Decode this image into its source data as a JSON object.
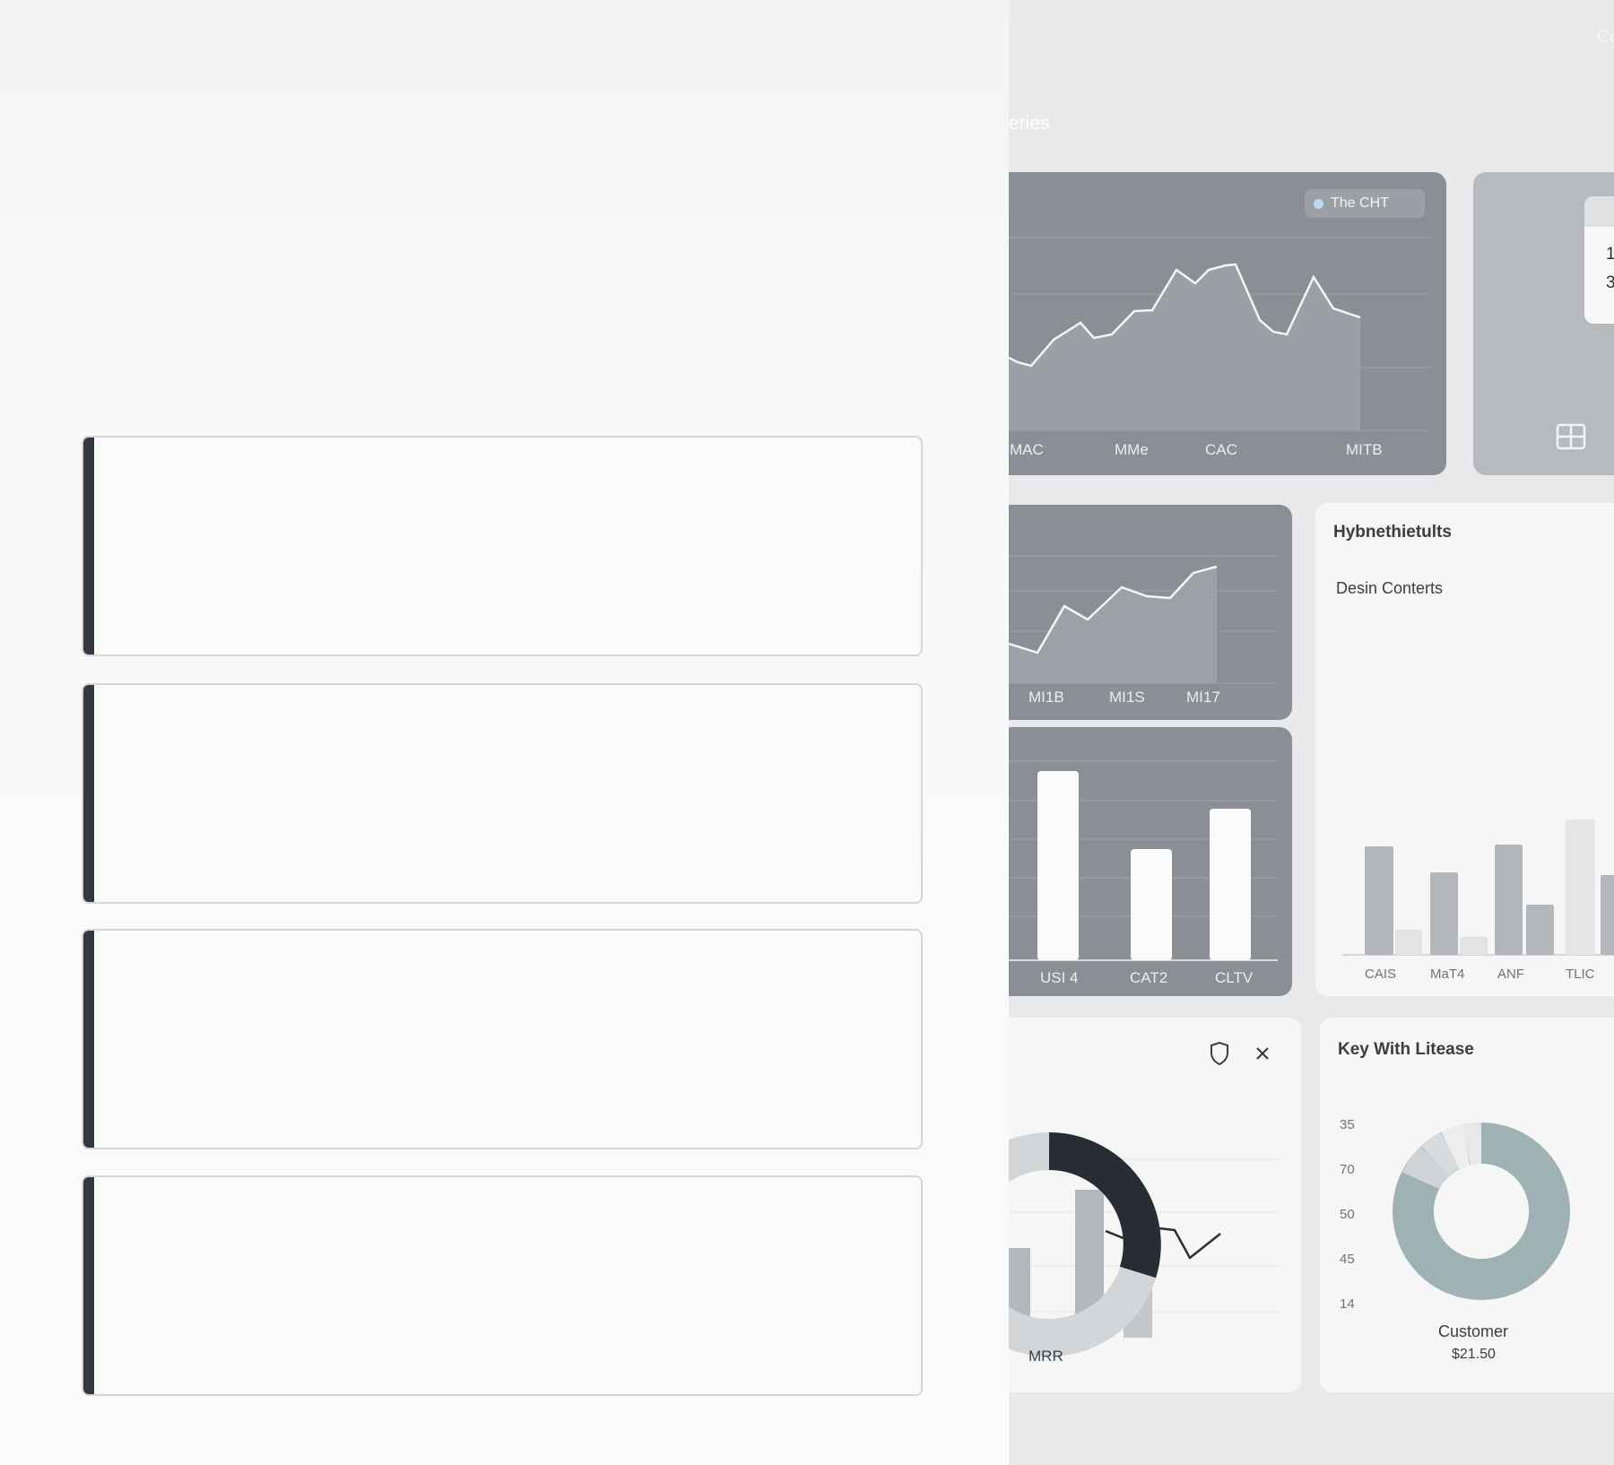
{
  "header": {
    "top_right_fragment": "Co",
    "section_fragment": "eries"
  },
  "panels": {
    "top_line": {
      "legend": "The CHT",
      "x_labels": [
        "MAC",
        "MMe",
        "CAC",
        "MITB"
      ]
    },
    "mid_line": {
      "x_labels": [
        "MI1B",
        "MI1S",
        "MI17"
      ]
    },
    "bar_gray": {
      "x_labels": [
        "USI 4",
        "CAT2",
        "CLTV"
      ]
    },
    "hybrid": {
      "title": "Hybnethietults",
      "subtitle": "Desin Conterts",
      "x_labels": [
        "CAIS",
        "MaT4",
        "ANF",
        "TLIC"
      ]
    },
    "donut_mrr": {
      "label": "MRR",
      "icons": [
        "shield-icon",
        "close-icon"
      ]
    },
    "key": {
      "title": "Key With Litease",
      "y_labels": [
        "35",
        "70",
        "50",
        "45",
        "14"
      ],
      "donut_label": "Customer",
      "donut_value": "$21.50"
    },
    "mini": {
      "values": [
        "1",
        "3"
      ],
      "icon": "grid-icon"
    }
  },
  "colors": {
    "dark_accent": "#323741",
    "panel_gray": "#8a8e95",
    "teal": "#9fb2b3",
    "dark_arc": "#282c34"
  }
}
